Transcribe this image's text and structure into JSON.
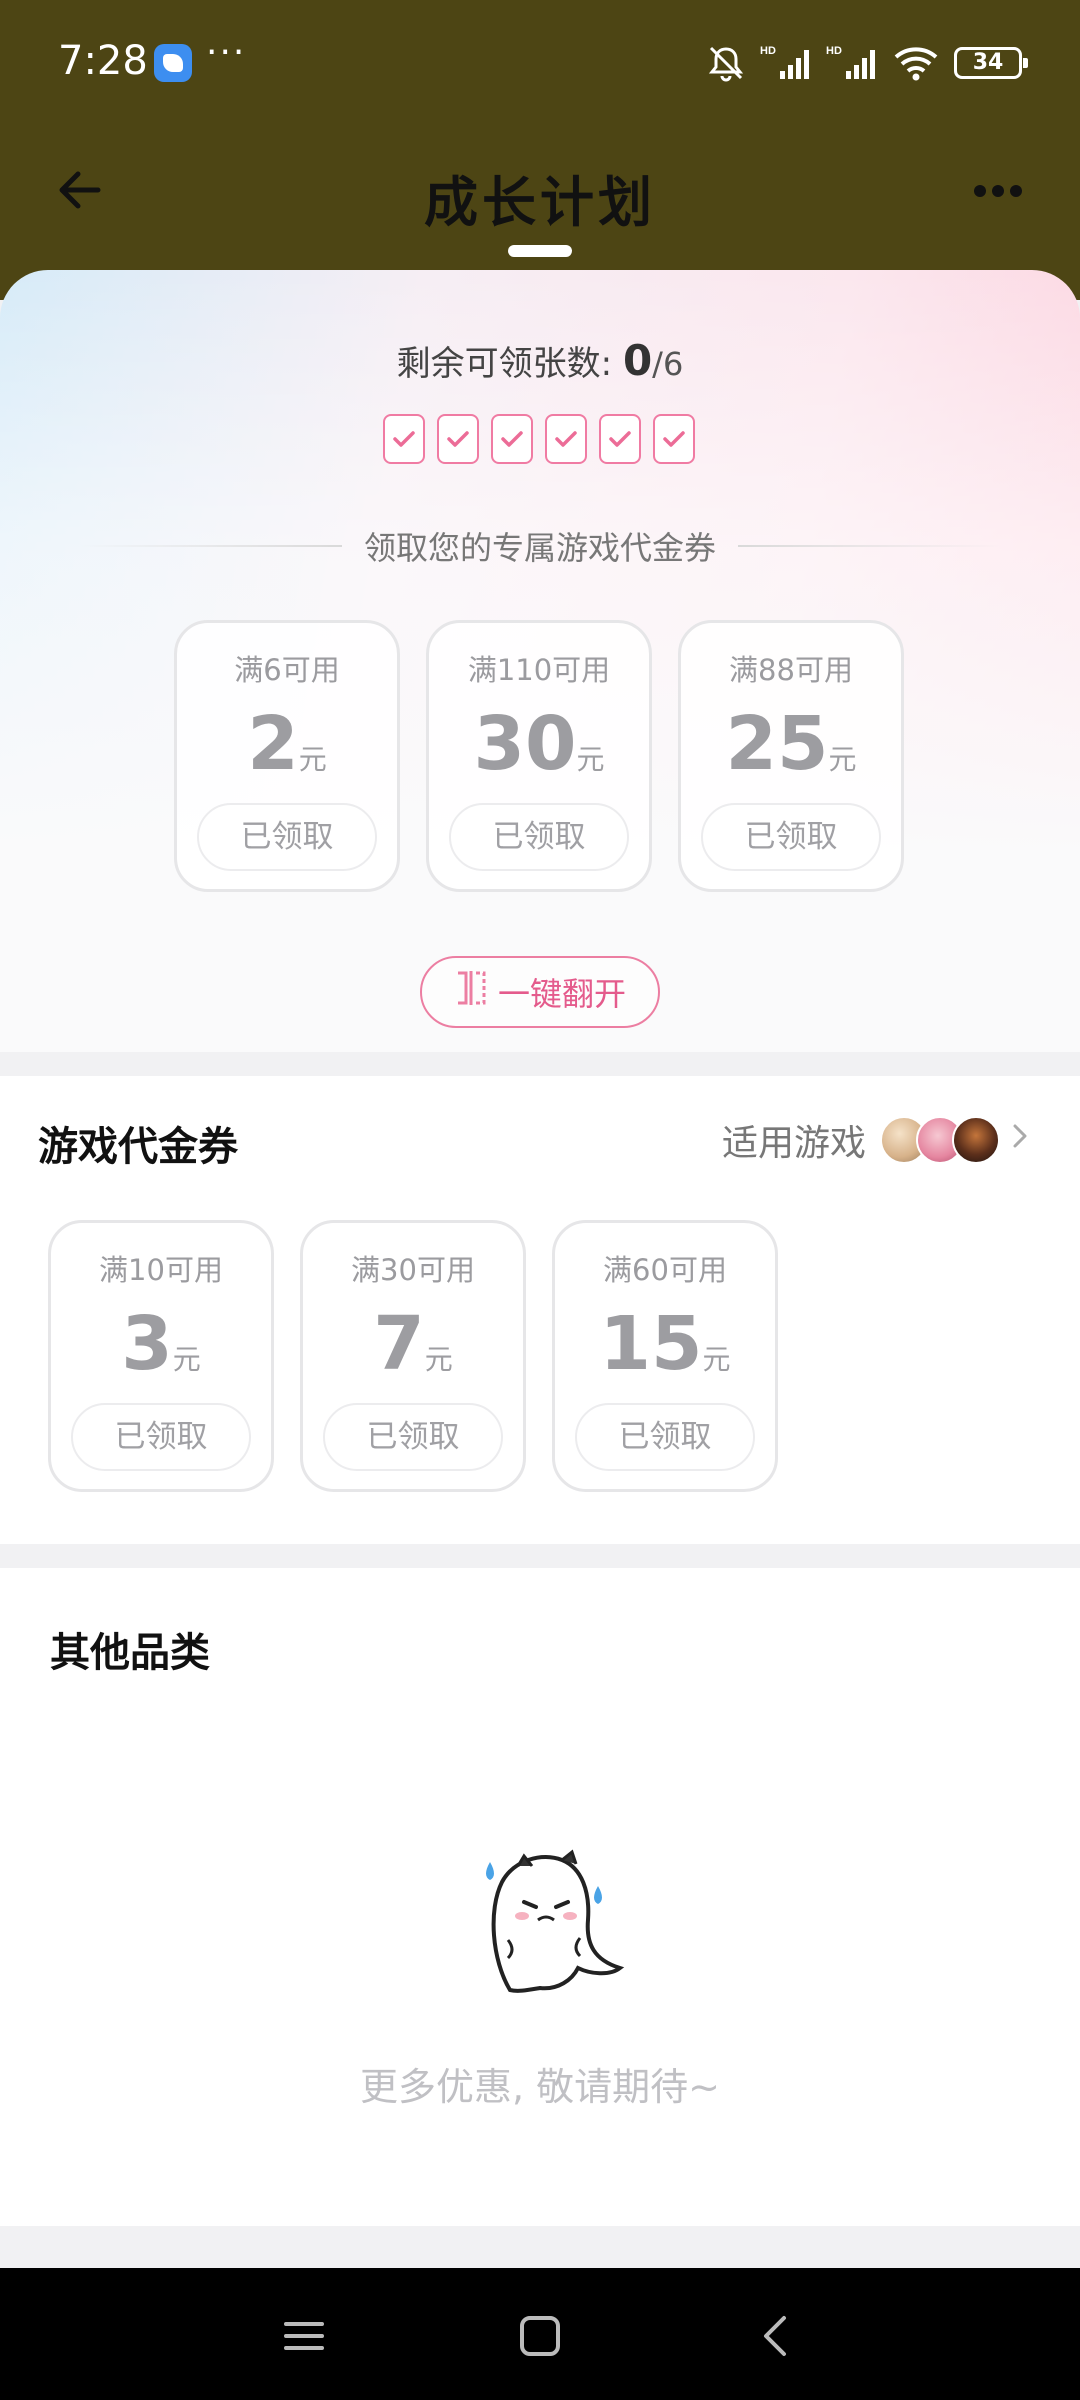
{
  "status_bar": {
    "time": "7:28",
    "dots": "···",
    "battery": "34",
    "hd1": "HD",
    "hd2": "HD"
  },
  "header": {
    "title": "成长计划"
  },
  "plan": {
    "remaining_label": "剩余可领张数: ",
    "remaining_count": "0",
    "remaining_total": "/6",
    "checked_count": 6,
    "divider_text": "领取您的专属游戏代金券",
    "coupons": [
      {
        "condition": "满6可用",
        "amount": "2",
        "unit": "元",
        "status": "已领取"
      },
      {
        "condition": "满110可用",
        "amount": "30",
        "unit": "元",
        "status": "已领取"
      },
      {
        "condition": "满88可用",
        "amount": "25",
        "unit": "元",
        "status": "已领取"
      }
    ],
    "flip_button": "一键翻开"
  },
  "voucher_section": {
    "title": "游戏代金券",
    "applicable_label": "适用游戏",
    "coupons": [
      {
        "condition": "满10可用",
        "amount": "3",
        "unit": "元",
        "status": "已领取"
      },
      {
        "condition": "满30可用",
        "amount": "7",
        "unit": "元",
        "status": "已领取"
      },
      {
        "condition": "满60可用",
        "amount": "15",
        "unit": "元",
        "status": "已领取"
      }
    ]
  },
  "other_section": {
    "title": "其他品类",
    "empty_text": "更多优惠, 敬请期待~"
  },
  "colors": {
    "header_bg": "#4d4514",
    "accent_pink": "#ec7ea2",
    "muted_gray": "#9d9da1"
  }
}
